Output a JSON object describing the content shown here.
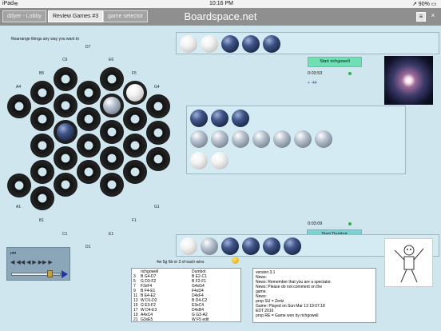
{
  "status_bar": {
    "device": "iPad",
    "wifi": "≋",
    "time": "10:16 PM",
    "battery": "↗ 90% ▭"
  },
  "top_bar": {
    "lobby_button": "ddyer - Lobby",
    "review_button": "Review Games #3",
    "selector_button": "game selector",
    "title": "Boardspace.net",
    "menu_icon": "≡",
    "close_icon": "×"
  },
  "board": {
    "hint": "Rearrange things any way you want to",
    "coords": {
      "D7": "D7",
      "C6": "C6",
      "E6": "E6",
      "B5": "B5",
      "F5": "F5",
      "A4": "A4",
      "G4": "G4",
      "A1": "A1",
      "G1": "G1",
      "B1": "B1",
      "F1": "F1",
      "C1": "C1",
      "E1": "E1",
      "D1": "D1"
    }
  },
  "players": {
    "top": {
      "name": "richgowell",
      "start_label": "Start richgowell",
      "clock": "0:03:53",
      "captures": "+ -44"
    },
    "bottom": {
      "name": "Dumbot",
      "start_label": "Start Dumbot",
      "clock": "0:03:09"
    }
  },
  "win_rule": "4w 5g 6b or 3 of each wins",
  "game_log": {
    "headers": {
      "player1": "richgowell",
      "player2": "Dumbot"
    },
    "rows": [
      {
        "n": "3",
        "p1": "B G4-D7",
        "p2": "B E2-C1"
      },
      {
        "n": "5",
        "p1": "G D3-F2",
        "p2": "B F2-F1"
      },
      {
        "n": "7",
        "p1": "F3xF4",
        "p2": "G4xG4"
      },
      {
        "n": "9",
        "p1": "B F4-E1",
        "p2": "F4xD4"
      },
      {
        "n": "11",
        "p1": "B E4-E2",
        "p2": "D4xF4"
      },
      {
        "n": "13",
        "p1": "W D1-D2",
        "p2": "B D4-C2"
      },
      {
        "n": "15",
        "p1": "G E3-F2",
        "p2": "E3xC4"
      },
      {
        "n": "17",
        "p1": "W D4-E3",
        "p2": "D4xB4"
      },
      {
        "n": "19",
        "p1": "A4xC4",
        "p2": "G G3-A2"
      },
      {
        "n": "21",
        "p1": "G3xE5",
        "p2": "W F5 edit"
      }
    ]
  },
  "info_panel": {
    "lines": [
      "version 3.1",
      "News:",
      "News: Remember that you are a spectator.",
      "News: Please do not comment on the",
      "game.",
      "News:",
      "prop SU = Zertz",
      "Game: Played on Sun Mar 13 19:07:18",
      "EDT 2016",
      "prop RE = Game won by richgowell"
    ]
  },
  "controls": {
    "first_icon": "⏮",
    "row_icons": "◀ ◀◀ ◀ ▶ ▶▶ ▶",
    "playback_progress": 0.78
  },
  "colors": {
    "accent_green": "#6fe0b4",
    "clock_dot": "#2bb24c",
    "board_bg": "#cfe6ef"
  }
}
